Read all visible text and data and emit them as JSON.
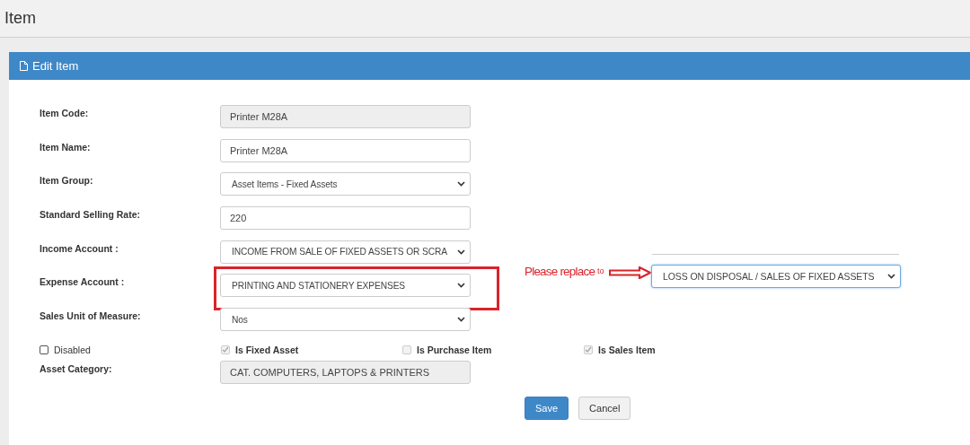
{
  "page": {
    "title": "Item"
  },
  "panel": {
    "title": "Edit Item"
  },
  "fields": [
    {
      "label": "Item Code:",
      "kind": "text",
      "value": "Printer M28A",
      "disabled": true,
      "highlighted": false
    },
    {
      "label": "Item Name:",
      "kind": "text",
      "value": "Printer M28A",
      "disabled": false,
      "highlighted": false
    },
    {
      "label": "Item Group:",
      "kind": "select",
      "value": "Asset Items - Fixed Assets",
      "disabled": false,
      "highlighted": false
    },
    {
      "label": "Standard Selling Rate:",
      "kind": "text",
      "value": "220",
      "disabled": false,
      "highlighted": false
    },
    {
      "label": "Income Account :",
      "kind": "select",
      "value": "INCOME FROM SALE OF FIXED ASSETS OR SCRA",
      "disabled": false,
      "highlighted": false
    },
    {
      "label": "Expense Account :",
      "kind": "select",
      "value": "PRINTING AND STATIONERY EXPENSES",
      "disabled": false,
      "highlighted": true
    },
    {
      "label": "Sales Unit of Measure:",
      "kind": "select",
      "value": "Nos",
      "disabled": false,
      "highlighted": false
    }
  ],
  "checkboxes": [
    {
      "label": "Disabled",
      "checked": false,
      "disabled": false
    },
    {
      "label": "Is Fixed Asset",
      "checked": true,
      "disabled": true
    },
    {
      "label": "Is Purchase Item",
      "checked": false,
      "disabled": true
    },
    {
      "label": "Is Sales Item",
      "checked": true,
      "disabled": true
    }
  ],
  "asset_category": {
    "label": "Asset Category:",
    "kind": "text",
    "value": "CAT. COMPUTERS, LAPTOPS & PRINTERS",
    "disabled": true
  },
  "annotation": {
    "note": "Please replace",
    "connector": "to",
    "replacement": "LOSS ON DISPOSAL / SALES OF FIXED ASSETS"
  },
  "buttons": [
    {
      "label": "Save",
      "kind": "primary"
    },
    {
      "label": "Cancel",
      "kind": "default"
    }
  ]
}
